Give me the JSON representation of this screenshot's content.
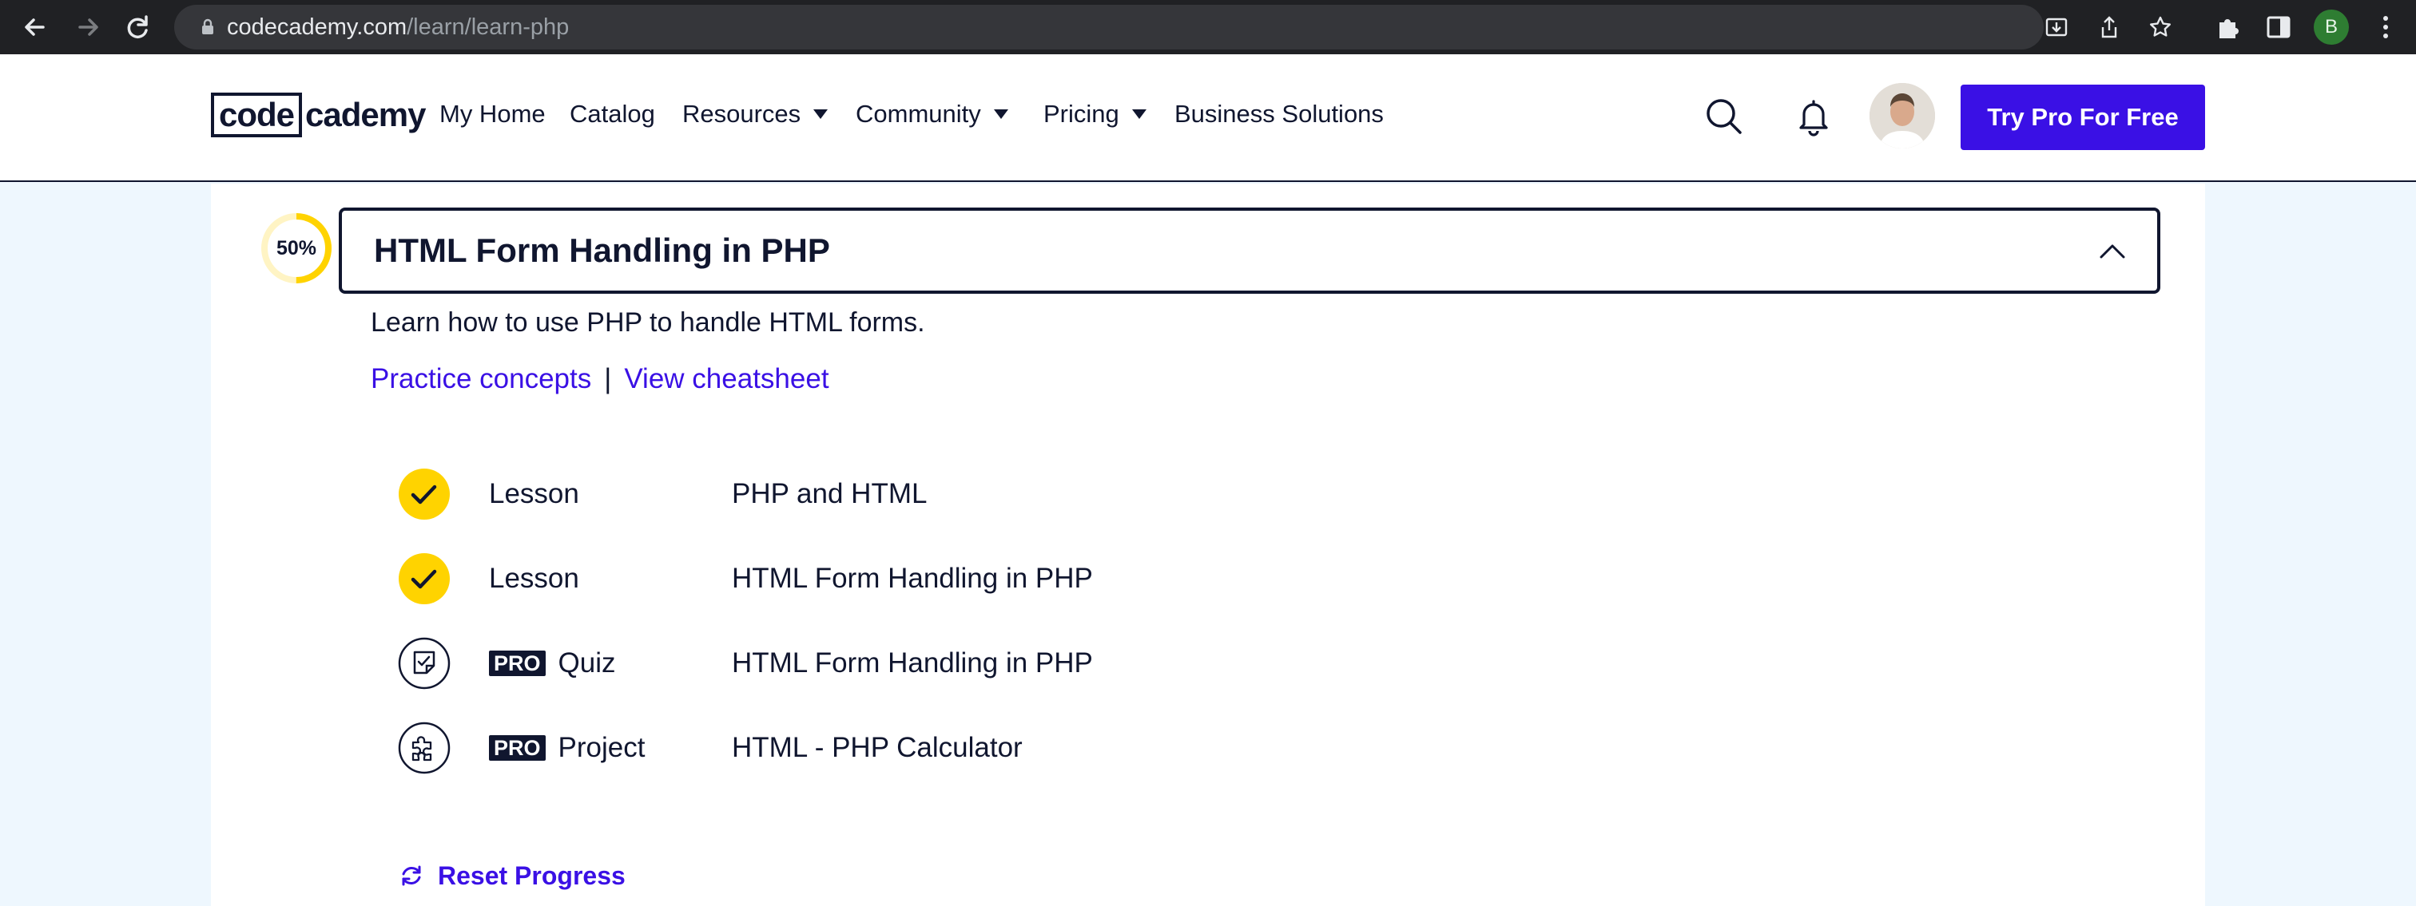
{
  "browser": {
    "url_host": "codecademy.com",
    "url_path": "/learn/learn-php",
    "profile_initial": "B"
  },
  "header": {
    "logo_part1": "code",
    "logo_part2": "cademy",
    "nav": {
      "my_home": "My Home",
      "catalog": "Catalog",
      "resources": "Resources",
      "community": "Community",
      "pricing": "Pricing",
      "business": "Business Solutions"
    },
    "cta": "Try Pro For Free"
  },
  "module": {
    "progress_label": "50%",
    "progress_fraction": 0.5,
    "title": "HTML Form Handling in PHP",
    "description": "Learn how to use PHP to handle HTML forms.",
    "practice_link": "Practice concepts",
    "separator": "|",
    "cheatsheet_link": "View cheatsheet",
    "pro_badge": "PRO",
    "items": [
      {
        "type": "Lesson",
        "name": "PHP and HTML",
        "pro": false,
        "icon": "check-complete-icon"
      },
      {
        "type": "Lesson",
        "name": "HTML Form Handling in PHP",
        "pro": false,
        "icon": "check-complete-icon"
      },
      {
        "type": "Quiz",
        "name": "HTML Form Handling in PHP",
        "pro": true,
        "icon": "quiz-icon"
      },
      {
        "type": "Project",
        "name": "HTML - PHP Calculator",
        "pro": true,
        "icon": "puzzle-icon"
      }
    ],
    "reset_label": "Reset Progress"
  },
  "colors": {
    "brand_blue": "#3a10e5",
    "navy": "#10162f",
    "complete_yellow": "#ffd300",
    "page_bg": "#eef7fe"
  }
}
